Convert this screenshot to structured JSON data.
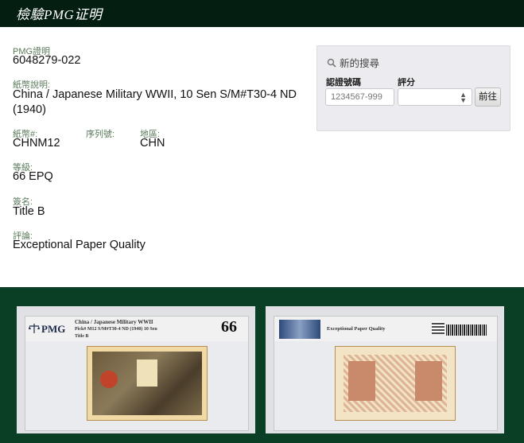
{
  "header": {
    "title": "檢驗PMG证明"
  },
  "details": {
    "cert_label": "PMG證明",
    "cert_value": "6048279-022",
    "desc_label": "紙幣說明:",
    "desc_value_line1": "China / Japanese Military WWII, 10 Sen S/M#T30-4 ND",
    "desc_value_line2": "(1940)",
    "note_no_label": "紙幣#:",
    "note_no_value": "CHNM12",
    "serial_label": "序列號:",
    "serial_value": "",
    "region_label": "地區:",
    "region_value": "CHN",
    "grade_label": "等級:",
    "grade_value": "66 EPQ",
    "signature_label": "簽名:",
    "signature_value": "Title B",
    "comments_label": "評論:",
    "comments_value": "Exceptional Paper Quality"
  },
  "search": {
    "heading": "新的搜尋",
    "cert_label": "認證號碼",
    "cert_placeholder": "1234567-999",
    "grade_label": "評分",
    "grade_selected": "",
    "go_label": "前往"
  },
  "slab": {
    "logo_text": "PMG",
    "line1": "China / Japanese Military WWII",
    "line2": "Pick# M12  S/M#T30-4  ND (1940)  10 Sen",
    "line3": "Title B",
    "grade": "66",
    "back_comment": "Exceptional Paper Quality"
  },
  "colors": {
    "topbar": "#041f12",
    "gallery_bg": "#0b3f25",
    "label": "#5a7a5a"
  }
}
